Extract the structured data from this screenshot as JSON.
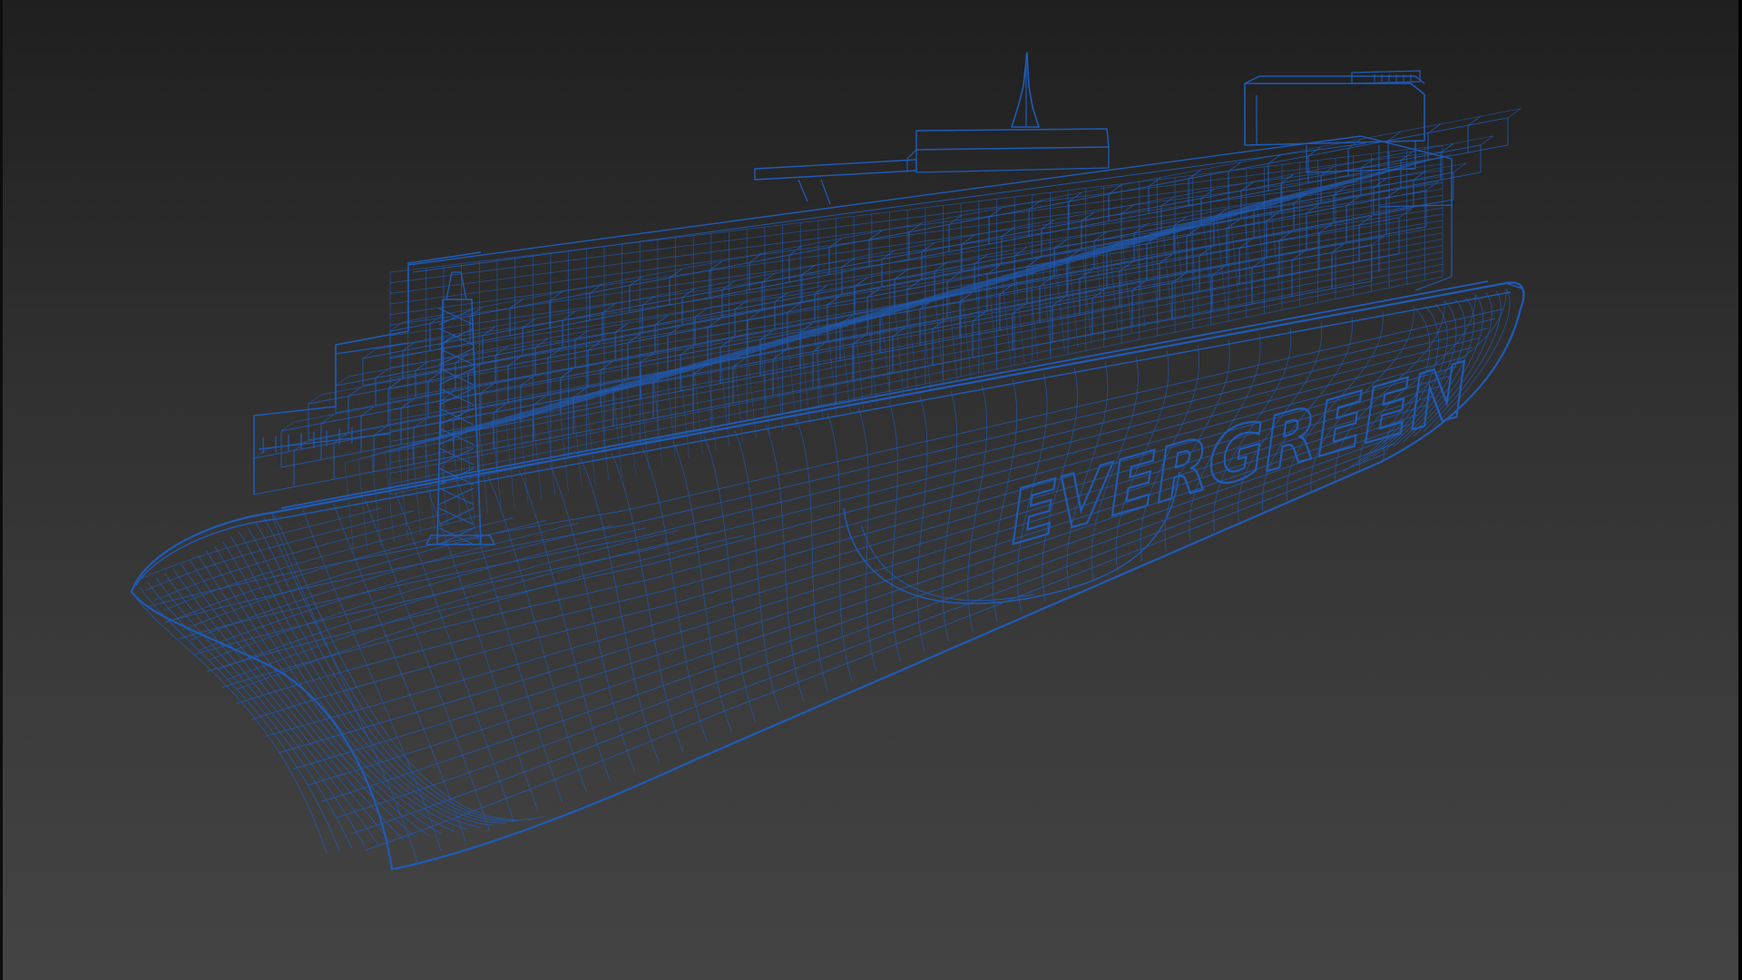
{
  "viewport": {
    "mode": "wireframe",
    "background": "#2f2f2f",
    "wire_color": "#1f5bb8"
  },
  "model": {
    "object": "container-ship",
    "hull_text": "EVERGREEN"
  }
}
